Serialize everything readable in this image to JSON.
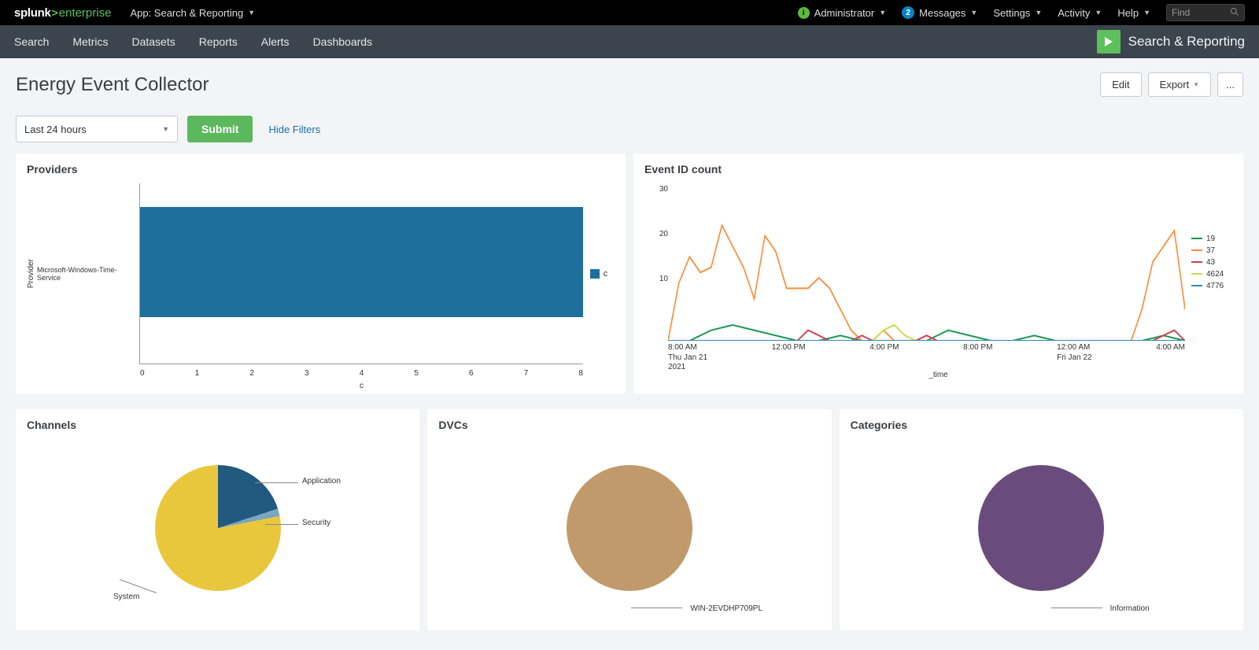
{
  "brand": {
    "splunk": "splunk",
    "arrow": ">",
    "enterprise": "enterprise"
  },
  "topbar": {
    "app_label": "App: Search & Reporting",
    "admin": "Administrator",
    "messages": "Messages",
    "messages_count": "2",
    "settings": "Settings",
    "activity": "Activity",
    "help": "Help",
    "find_placeholder": "Find"
  },
  "nav": {
    "items": [
      "Search",
      "Metrics",
      "Datasets",
      "Reports",
      "Alerts",
      "Dashboards"
    ],
    "app_name": "Search & Reporting"
  },
  "page": {
    "title": "Energy Event Collector",
    "edit": "Edit",
    "export": "Export",
    "more": "..."
  },
  "filters": {
    "time_label": "Last 24 hours",
    "submit": "Submit",
    "hide": "Hide Filters"
  },
  "panels": {
    "providers_title": "Providers",
    "eventid_title": "Event ID count",
    "channels_title": "Channels",
    "dvcs_title": "DVCs",
    "categories_title": "Categories",
    "time_axis": "_time"
  },
  "chart_data": [
    {
      "id": "providers",
      "type": "bar",
      "orientation": "horizontal",
      "xlabel": "c",
      "ylabel": "Provider",
      "x_ticks": [
        0,
        1,
        2,
        3,
        4,
        5,
        6,
        7,
        8
      ],
      "categories": [
        "Microsoft-Windows-Time-Service"
      ],
      "values": [
        8
      ],
      "legend": [
        "c"
      ],
      "colors": {
        "c": "#1e6f9c"
      }
    },
    {
      "id": "event_id_count",
      "type": "line",
      "xlabel": "_time",
      "ylim": [
        0,
        30
      ],
      "y_ticks": [
        10,
        20,
        30
      ],
      "x_ticks": [
        {
          "label": "8:00 AM",
          "sub": "Thu Jan 21",
          "sub2": "2021"
        },
        {
          "label": "12:00 PM"
        },
        {
          "label": "4:00 PM"
        },
        {
          "label": "8:00 PM"
        },
        {
          "label": "12:00 AM",
          "sub": "Fri Jan 22"
        },
        {
          "label": "4:00 AM"
        }
      ],
      "series": [
        {
          "name": "19",
          "color": "#1a9850",
          "values": [
            0,
            0,
            2,
            3,
            2,
            1,
            0,
            0,
            1,
            0,
            0,
            0,
            0,
            2,
            1,
            0,
            0,
            1,
            0,
            0,
            0,
            0,
            0,
            1,
            0
          ]
        },
        {
          "name": "37",
          "color": "#fc8d3c",
          "values": [
            0,
            11,
            16,
            13,
            14,
            22,
            18,
            14,
            8,
            20,
            17,
            10,
            10,
            10,
            12,
            10,
            6,
            2,
            0,
            0,
            2,
            0,
            0,
            0,
            1,
            0,
            0,
            0,
            0,
            0,
            0,
            0,
            0,
            0,
            0,
            0,
            0,
            0,
            0,
            0,
            0,
            0,
            0,
            0,
            6,
            15,
            18,
            21,
            6
          ]
        },
        {
          "name": "43",
          "color": "#d53e4f",
          "values": [
            0,
            0,
            0,
            0,
            0,
            0,
            0,
            0,
            0,
            0,
            0,
            0,
            0,
            2,
            1,
            0,
            0,
            0,
            1,
            0,
            0,
            0,
            0,
            0,
            1,
            0,
            0,
            0,
            0,
            0,
            0,
            0,
            0,
            0,
            0,
            0,
            0,
            0,
            0,
            0,
            0,
            0,
            0,
            0,
            0,
            0,
            1,
            2,
            0
          ]
        },
        {
          "name": "4624",
          "color": "#c7d94b",
          "values": [
            0,
            0,
            0,
            0,
            0,
            0,
            0,
            0,
            0,
            0,
            0,
            0,
            0,
            0,
            0,
            0,
            0,
            0,
            0,
            0,
            2,
            3,
            1,
            0,
            0,
            0,
            0,
            0,
            0,
            0,
            0,
            0,
            0,
            0,
            0,
            0,
            0,
            0,
            0,
            0,
            0,
            0,
            0,
            0,
            0,
            0,
            0,
            0,
            0
          ]
        },
        {
          "name": "4776",
          "color": "#3288bd",
          "values": [
            0,
            0,
            0,
            0,
            0,
            0,
            0,
            0,
            0,
            0,
            0,
            0,
            0,
            0,
            0,
            0,
            0,
            0,
            0,
            0,
            0,
            0,
            0,
            0,
            0,
            0,
            0,
            0,
            0,
            0,
            0,
            0,
            0,
            0,
            0,
            0,
            0,
            0,
            0,
            0,
            0,
            0,
            0,
            0,
            0,
            0,
            0,
            0,
            0
          ]
        }
      ]
    },
    {
      "id": "channels",
      "type": "pie",
      "slices": [
        {
          "label": "System",
          "value": 78,
          "color": "#e9c73d"
        },
        {
          "label": "Application",
          "value": 20,
          "color": "#21597f"
        },
        {
          "label": "Security",
          "value": 2,
          "color": "#7aa6c2"
        }
      ]
    },
    {
      "id": "dvcs",
      "type": "pie",
      "slices": [
        {
          "label": "WIN-2EVDHP709PL",
          "value": 100,
          "color": "#c19a6b"
        }
      ]
    },
    {
      "id": "categories",
      "type": "pie",
      "slices": [
        {
          "label": "Information",
          "value": 100,
          "color": "#6a4c7c"
        }
      ]
    }
  ]
}
